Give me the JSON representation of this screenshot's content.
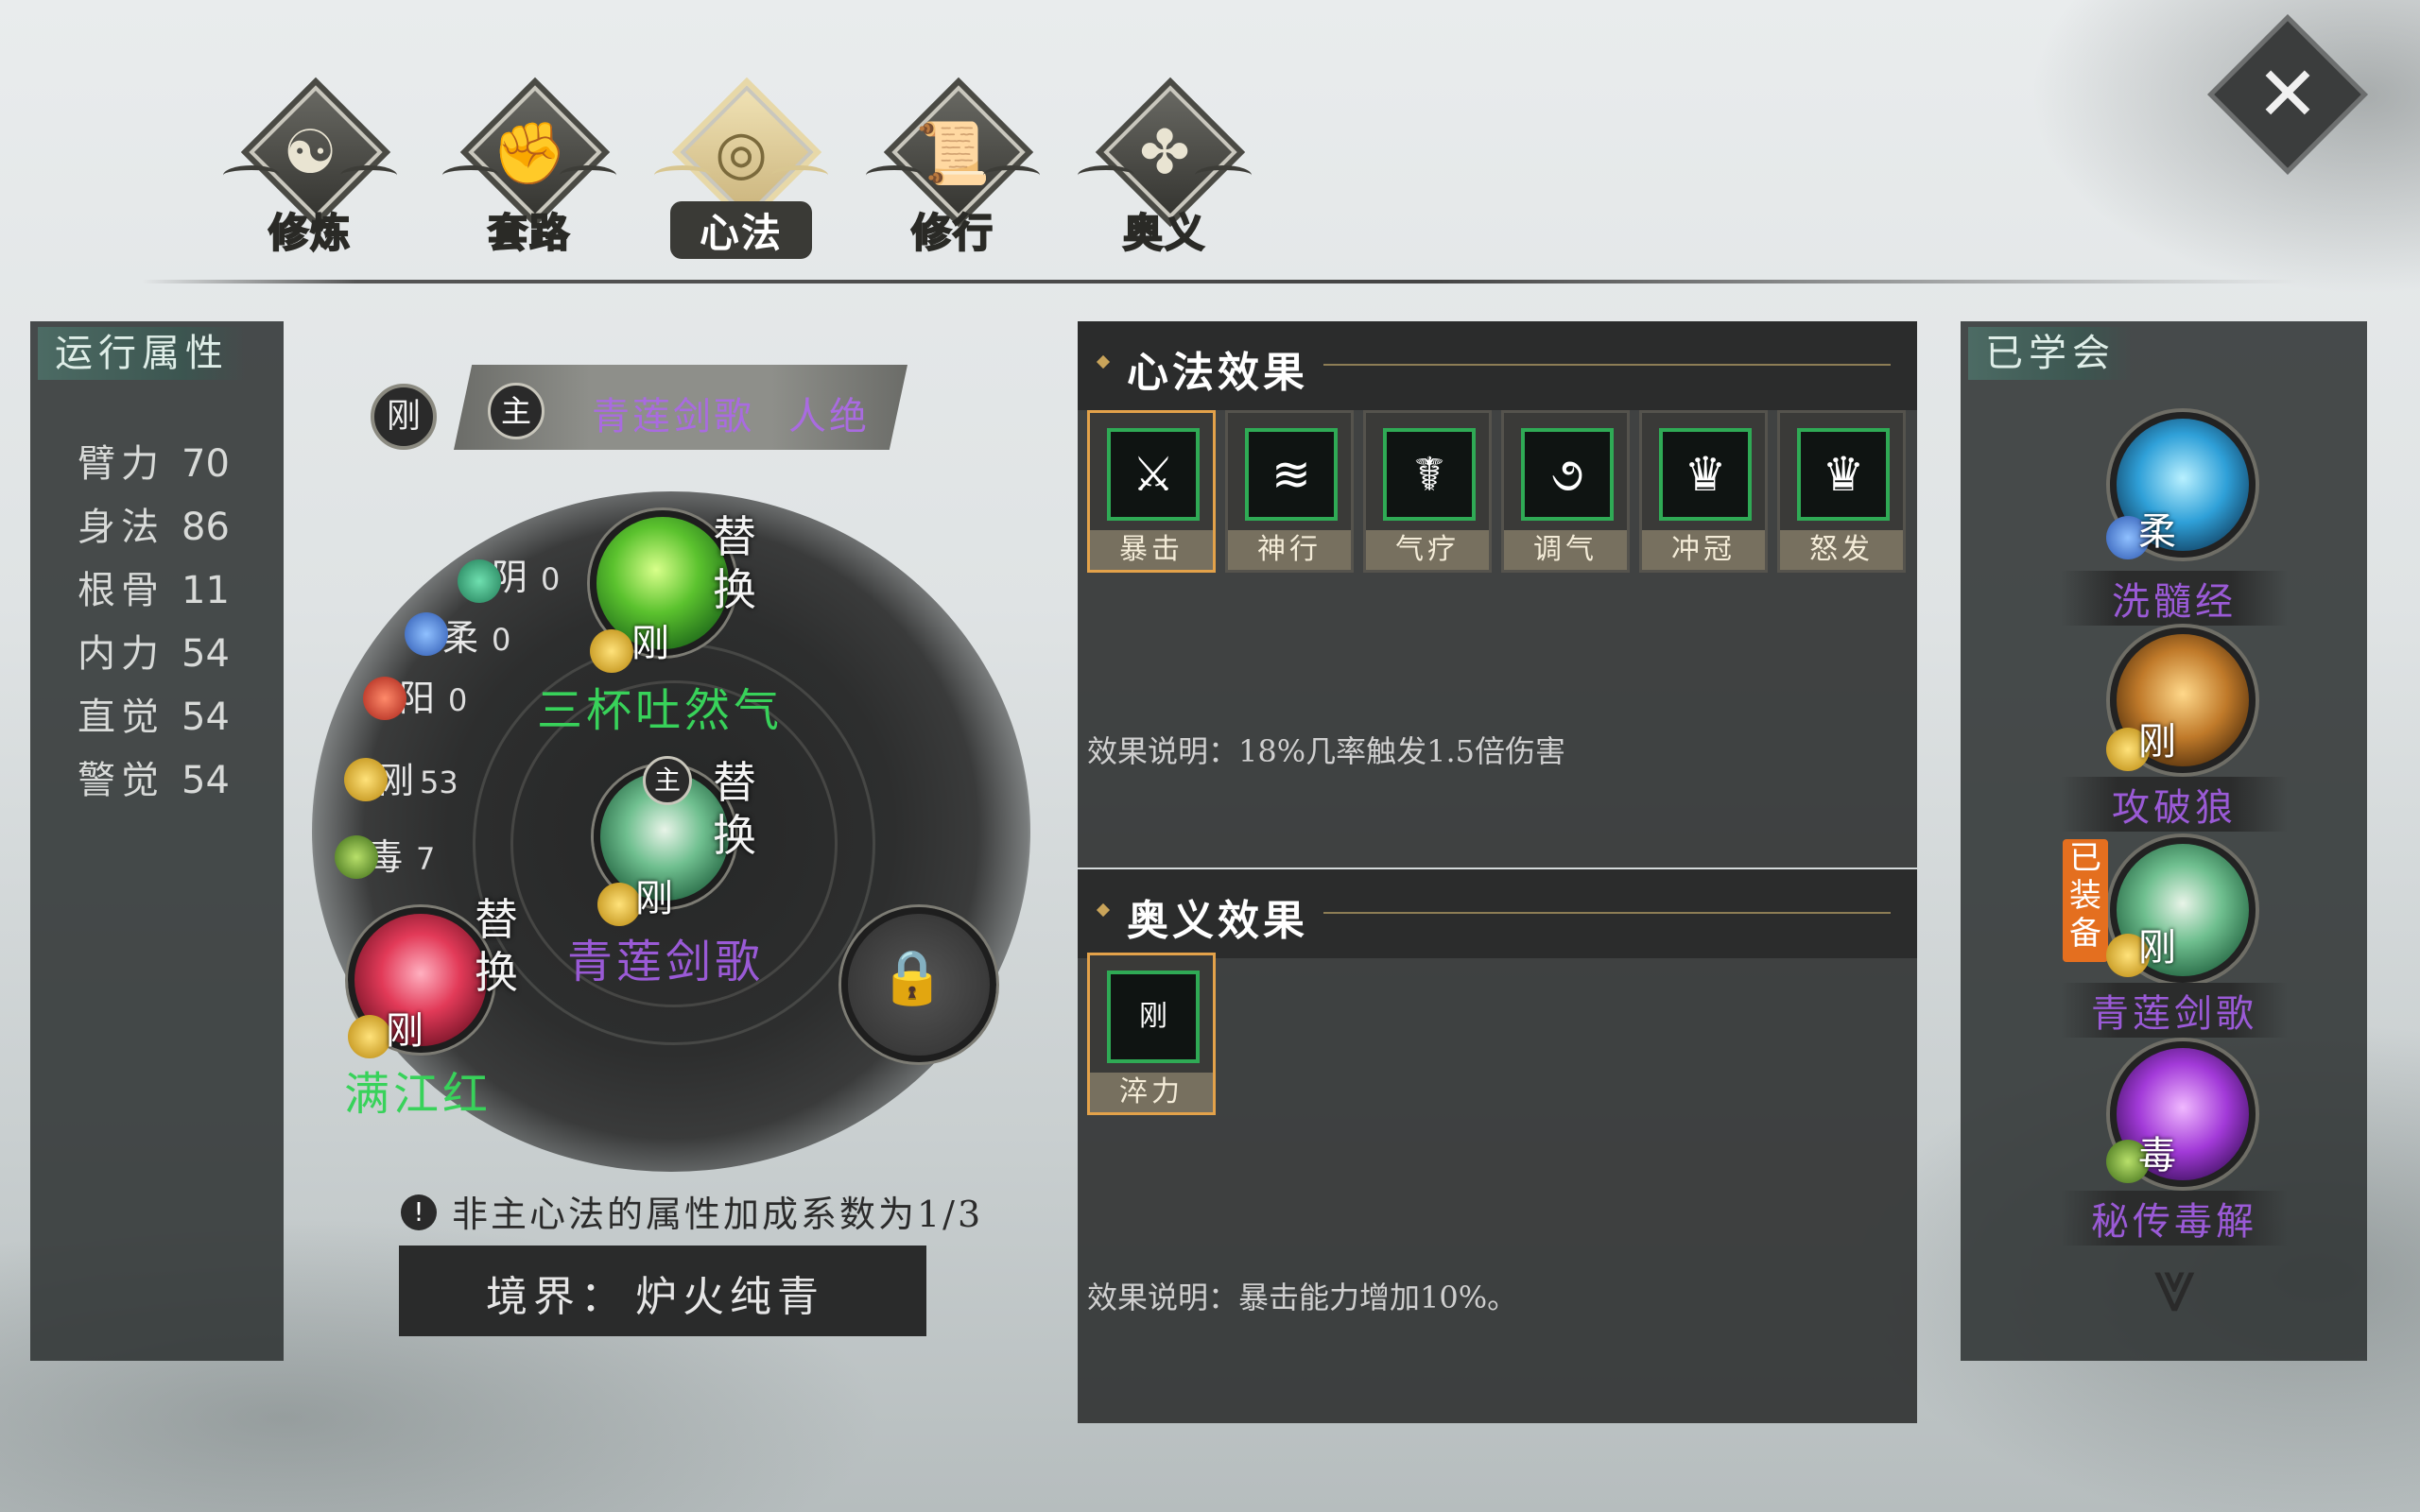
{
  "nav": {
    "tabs": [
      {
        "label": "修炼",
        "glyph": "☯"
      },
      {
        "label": "套路",
        "glyph": "✊"
      },
      {
        "label": "心法",
        "glyph": "◎"
      },
      {
        "label": "修行",
        "glyph": "📜"
      },
      {
        "label": "奥义",
        "glyph": "✤"
      }
    ],
    "active_index": 2,
    "close_glyph": "✕"
  },
  "attributes": {
    "title": "运行属性",
    "items": [
      {
        "name": "臂力",
        "value": "70"
      },
      {
        "name": "身法",
        "value": "86"
      },
      {
        "name": "根骨",
        "value": "11"
      },
      {
        "name": "内力",
        "value": "54"
      },
      {
        "name": "直觉",
        "value": "54"
      },
      {
        "name": "警觉",
        "value": "54"
      }
    ]
  },
  "center": {
    "type_badge": "刚",
    "main_badge": "主",
    "main_name": "青莲剑歌",
    "main_tier": "人绝",
    "elements": [
      {
        "name": "阴",
        "value": "0",
        "color": "#3aa07a"
      },
      {
        "name": "柔",
        "value": "0",
        "color": "#3f7ad0"
      },
      {
        "name": "阳",
        "value": "0",
        "color": "#d03a2a"
      },
      {
        "name": "刚",
        "value": "53",
        "color": "#d6a21e"
      },
      {
        "name": "毒",
        "value": "7",
        "color": "#5b8f2a"
      }
    ],
    "skills": [
      {
        "name": "三杯吐然气",
        "type": "刚",
        "swap": "替换",
        "color": "#38d25a"
      },
      {
        "name": "青莲剑歌",
        "type": "刚",
        "swap": "替换",
        "color": "#9a5ad6",
        "main": "主"
      },
      {
        "name": "满江红",
        "type": "刚",
        "swap": "替换",
        "color": "#38d25a"
      }
    ],
    "note": "非主心法的属性加成系数为1/3",
    "realm_label": "境界：",
    "realm_value": "炉火纯青"
  },
  "effects": {
    "title": "心法效果",
    "cards": [
      {
        "name": "暴击",
        "icon": "sword-icon",
        "glyph": "⚔"
      },
      {
        "name": "神行",
        "icon": "boot-icon",
        "glyph": "≋"
      },
      {
        "name": "气疗",
        "icon": "heal-icon",
        "glyph": "☤"
      },
      {
        "name": "调气",
        "icon": "swirl-icon",
        "glyph": "૭"
      },
      {
        "name": "冲冠",
        "icon": "crown-icon",
        "glyph": "♛"
      },
      {
        "name": "怒发",
        "icon": "rage-icon",
        "glyph": "♛"
      }
    ],
    "desc": "效果说明：18%几率触发1.5倍伤害"
  },
  "mystic": {
    "title": "奥义效果",
    "cards": [
      {
        "name": "淬力",
        "glyph": "刚"
      }
    ],
    "desc": "效果说明：暴击能力增加10%。"
  },
  "learned": {
    "title": "已学会",
    "equipped_label": "已装备",
    "items": [
      {
        "name": "洗髓经",
        "type": "柔",
        "color": "#9a5ad6"
      },
      {
        "name": "攻破狼",
        "type": "刚",
        "color": "#9a5ad6"
      },
      {
        "name": "青莲剑歌",
        "type": "刚",
        "color": "#9a5ad6"
      },
      {
        "name": "秘传毒解",
        "type": "毒",
        "color": "#9a5ad6"
      }
    ],
    "scroll_glyph": "⩔"
  }
}
